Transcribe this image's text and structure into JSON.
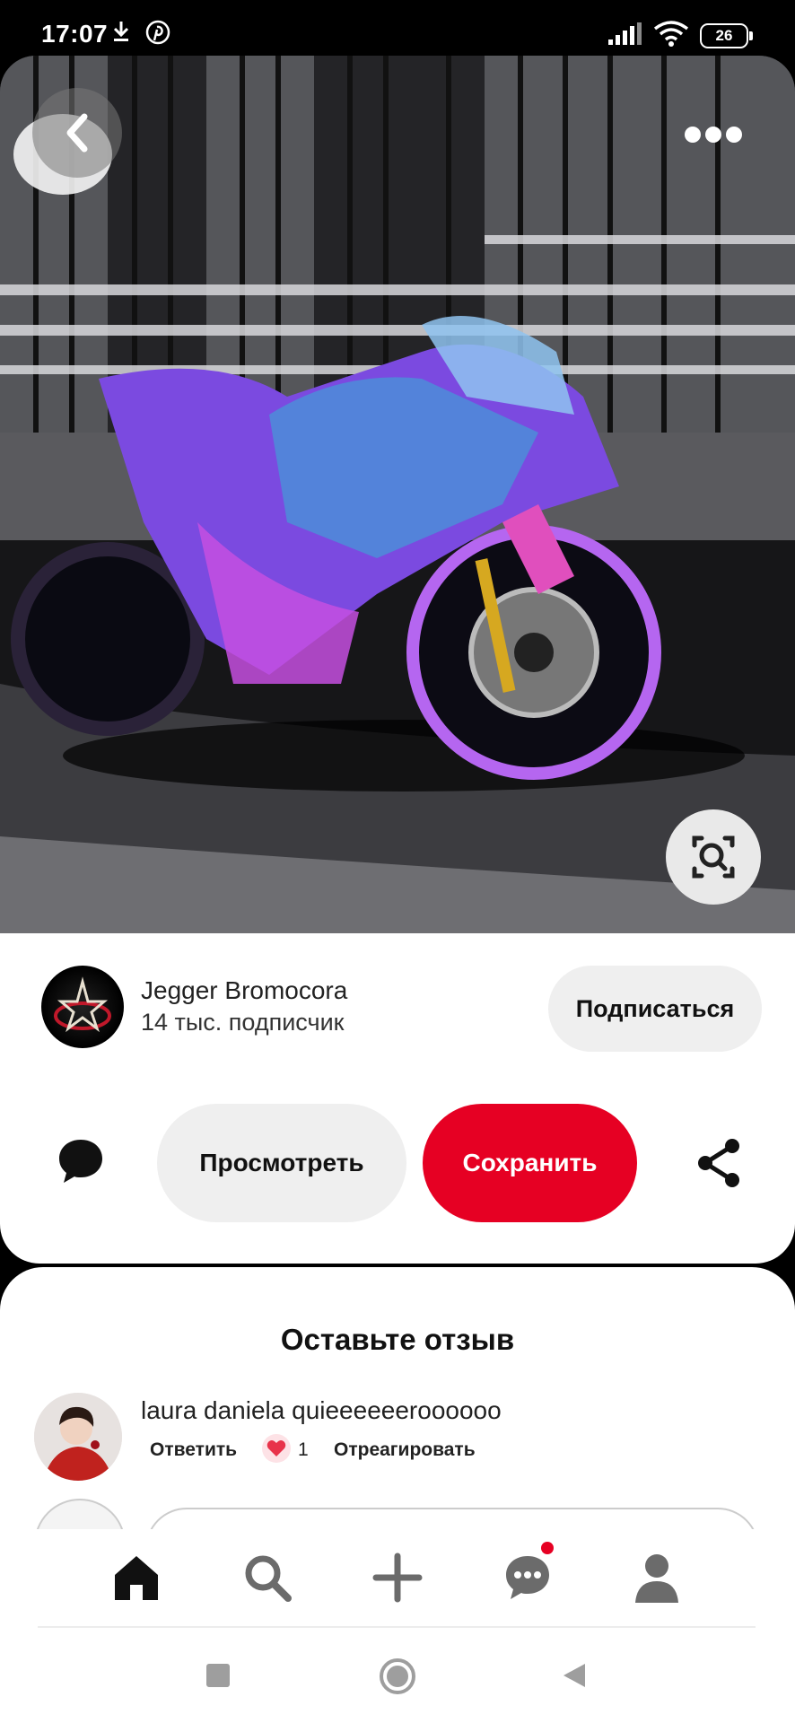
{
  "status_bar": {
    "time": "17:07",
    "battery": "26",
    "icons": [
      "download-icon",
      "pinterest-icon",
      "signal-icon",
      "wifi-icon",
      "battery-icon"
    ]
  },
  "pin": {
    "image_description_icon": "photo",
    "author_name": "Jegger Bromocora",
    "followers": "14 тыс. подписчик",
    "follow_label": "Подписаться",
    "view_label": "Просмотреть",
    "save_label": "Сохранить"
  },
  "reviews": {
    "title": "Оставьте отзыв",
    "comment": {
      "text": "laura daniela quieeeeeeroooooo",
      "reply_label": "Ответить",
      "reaction_count": "1",
      "react_label": "Отреагировать"
    }
  },
  "bottom_nav": {
    "items": [
      "home-icon",
      "search-icon",
      "plus-icon",
      "chat-icon",
      "profile-icon"
    ]
  },
  "colors": {
    "save": "#e60023",
    "secondary_button": "#efefef",
    "notification_dot": "#e60023"
  }
}
